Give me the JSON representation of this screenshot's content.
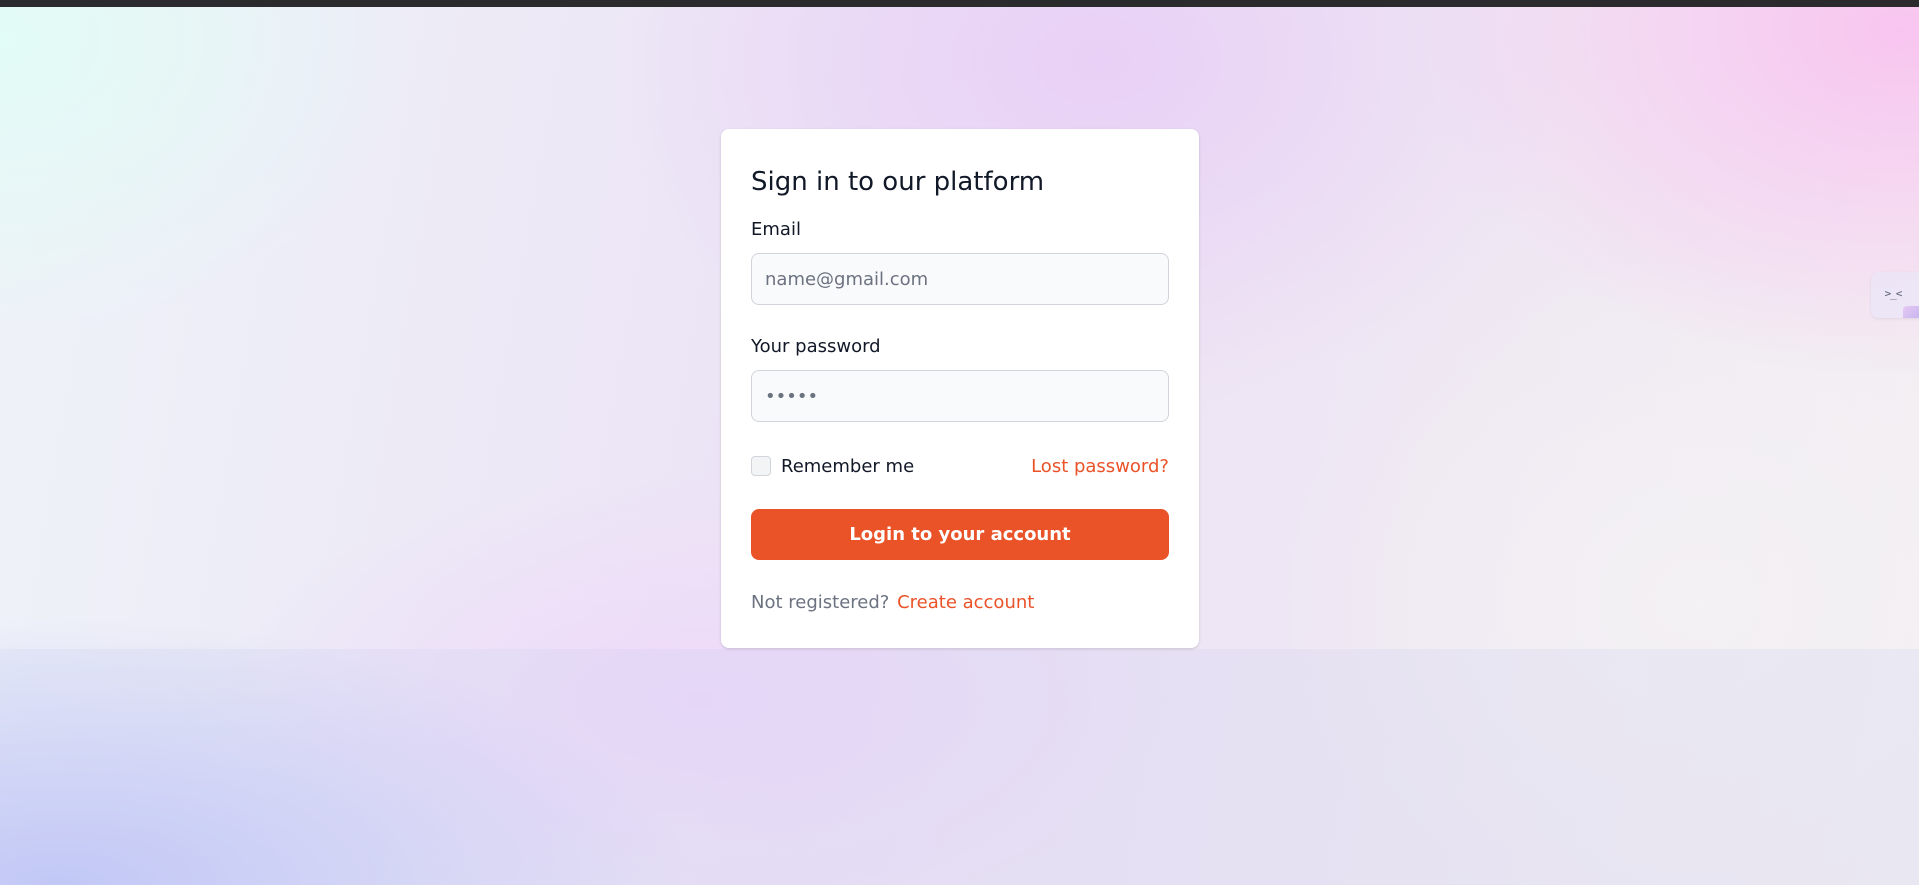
{
  "login": {
    "title": "Sign in to our platform",
    "email_label": "Email",
    "email_placeholder": "name@gmail.com",
    "email_value": "",
    "password_label": "Your password",
    "password_value": "•••••",
    "remember_label": "Remember me",
    "remember_checked": false,
    "lost_password_link": "Lost password?",
    "submit_label": "Login to your account",
    "not_registered_text": "Not registered?",
    "create_account_link": "Create account"
  },
  "side_widget": {
    "icon": "collapse-arrows-icon",
    "glyph": ">_<"
  },
  "colors": {
    "accent": "#ea5228",
    "text": "#111827",
    "muted": "#6b7280",
    "input_bg": "#f9fafb",
    "input_border": "#d1d5db"
  }
}
